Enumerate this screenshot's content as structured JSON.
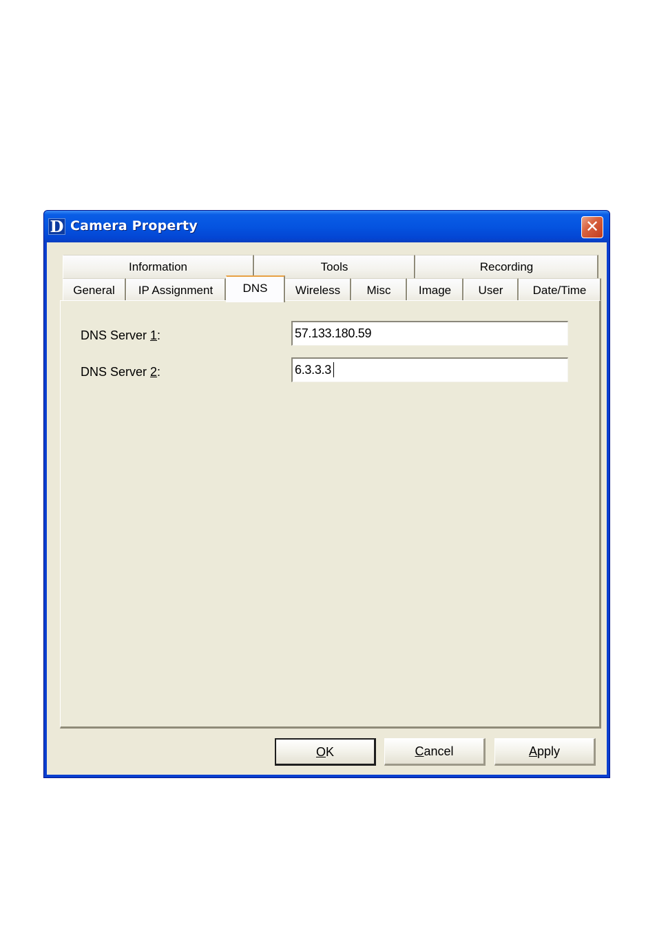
{
  "window": {
    "title": "Camera Property",
    "logo_letter": "D",
    "close_glyph": "✕",
    "icons": {
      "app": "d-link-logo-icon",
      "close": "close-icon"
    }
  },
  "tabs": {
    "top_row": [
      {
        "label": "Information"
      },
      {
        "label": "Tools"
      },
      {
        "label": "Recording"
      }
    ],
    "bottom_row": [
      {
        "label": "General"
      },
      {
        "label": "IP Assignment"
      },
      {
        "label": "DNS",
        "selected": true
      },
      {
        "label": "Wireless"
      },
      {
        "label": "Misc"
      },
      {
        "label": "Image"
      },
      {
        "label": "User"
      },
      {
        "label": "Date/Time"
      }
    ]
  },
  "dns": {
    "server1": {
      "label_prefix": "DNS Server ",
      "label_accel": "1",
      "label_suffix": ":",
      "value": "57.133.180.59"
    },
    "server2": {
      "label_prefix": "DNS Server ",
      "label_accel": "2",
      "label_suffix": ":",
      "value": "6.3.3.3"
    }
  },
  "buttons": {
    "ok": {
      "accel": "O",
      "rest": "K"
    },
    "cancel": {
      "accel": "C",
      "rest": "ancel"
    },
    "apply": {
      "accel": "A",
      "rest": "pply"
    }
  },
  "colors": {
    "titlebar": "#0554e0",
    "dialog_bg": "#ece9d8",
    "close_button": "#d8623f",
    "selected_tab_highlight": "#e8a043"
  }
}
